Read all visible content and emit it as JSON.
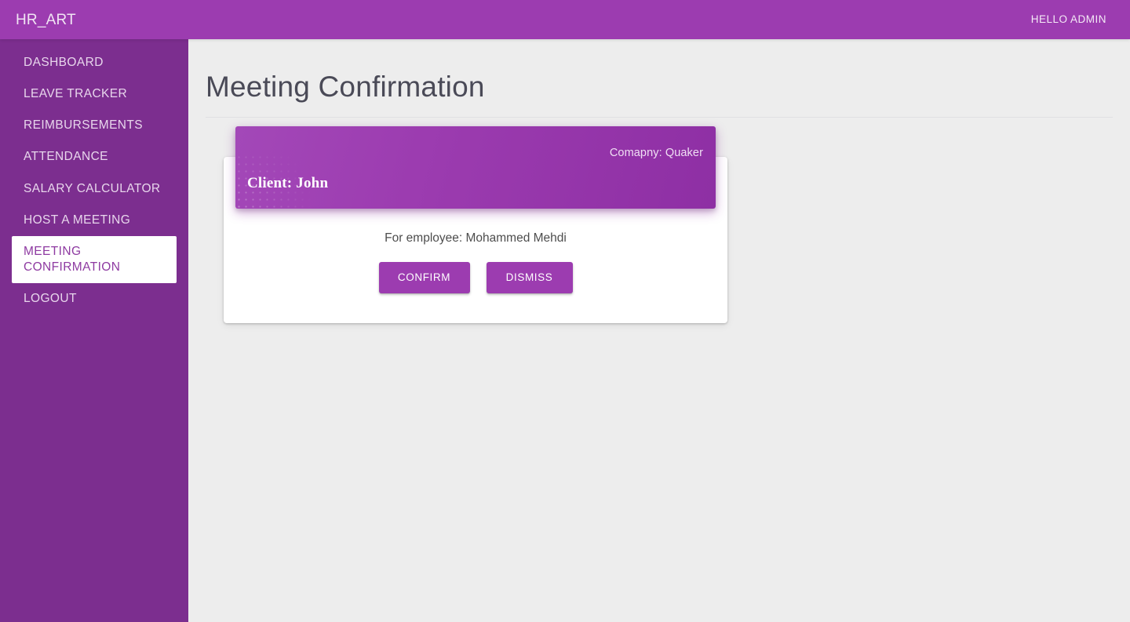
{
  "appbar": {
    "brand": "HR_ART",
    "user_greeting": "HELLO ADMIN",
    "background_color": "#9c3cb0"
  },
  "sidebar": {
    "background_color": "#7c2e8f",
    "active_background_color": "#ffffff",
    "active_text_color": "#8e3aa1",
    "items": [
      {
        "label": "DASHBOARD",
        "active": false
      },
      {
        "label": "LEAVE TRACKER",
        "active": false
      },
      {
        "label": "REIMBURSEMENTS",
        "active": false
      },
      {
        "label": "ATTENDANCE",
        "active": false
      },
      {
        "label": "SALARY CALCULATOR",
        "active": false
      },
      {
        "label": "HOST A MEETING",
        "active": false
      },
      {
        "label": "MEETING CONFIRMATION",
        "active": true
      },
      {
        "label": "LOGOUT",
        "active": false
      }
    ]
  },
  "main": {
    "page_title": "Meeting Confirmation",
    "background_color": "#ededed",
    "meeting_card": {
      "company_label": "Comapny: Quaker",
      "client_label": "Client: John",
      "employee_label": "For employee: Mohammed Mehdi",
      "banner_color": "#9c3cb0",
      "confirm_button": "CONFIRM",
      "dismiss_button": "DISMISS"
    }
  }
}
